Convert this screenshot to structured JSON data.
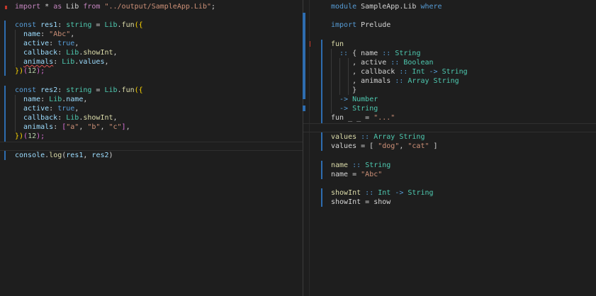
{
  "left": {
    "imp_keyword": "import",
    "imp_star": " * ",
    "imp_as": "as",
    "imp_lib": " Lib ",
    "imp_from": "from",
    "imp_path": "\"../output/SampleApp.Lib\"",
    "imp_semi": ";",
    "res1": {
      "const_kw": "const",
      "name": " res1",
      "colon": ": ",
      "type": "string",
      "eq": " = ",
      "lib": "Lib",
      "dot": ".",
      "fun": "fun",
      "open": "({",
      "name_key": "  name",
      "name_colon": ": ",
      "name_val": "\"Abc\"",
      "name_comma": ",",
      "active_key": "  active",
      "active_colon": ": ",
      "active_val": "true",
      "active_comma": ",",
      "callback_key": "  callback",
      "callback_colon": ": ",
      "callback_lib": "Lib",
      "callback_dot": ".",
      "callback_fn": "showInt",
      "callback_comma": ",",
      "animals_key": "animals",
      "animals_colon": ": ",
      "animals_lib": "Lib",
      "animals_dot": ".",
      "animals_val": "values",
      "animals_comma": ",",
      "close": "})",
      "arg_open": "(",
      "arg": "12",
      "arg_close": ");"
    },
    "res2": {
      "const_kw": "const",
      "name": " res2",
      "colon": ": ",
      "type": "string",
      "eq": " = ",
      "lib": "Lib",
      "dot": ".",
      "fun": "fun",
      "open": "({",
      "name_key": "  name",
      "name_colon": ": ",
      "name_lib": "Lib",
      "name_dot": ".",
      "name_val": "name",
      "name_comma": ",",
      "active_key": "  active",
      "active_colon": ": ",
      "active_val": "true",
      "active_comma": ",",
      "callback_key": "  callback",
      "callback_colon": ": ",
      "callback_lib": "Lib",
      "callback_dot": ".",
      "callback_fn": "showInt",
      "callback_comma": ",",
      "animals_key": "  animals",
      "animals_colon": ": ",
      "arr_open": "[",
      "a": "\"a\"",
      "sep1": ", ",
      "b": "\"b\"",
      "sep2": ", ",
      "c": "\"c\"",
      "arr_close": "]",
      "animals_comma": ",",
      "close": "})",
      "arg_open": "(",
      "arg": "12",
      "arg_close": ");"
    },
    "console": {
      "obj": "console",
      "dot": ".",
      "fn": "log",
      "open": "(",
      "a1": "res1",
      "sep": ", ",
      "a2": "res2",
      "close": ")"
    }
  },
  "right": {
    "module_kw": "module",
    "module_name": " SampleApp.Lib ",
    "where_kw": "where",
    "import_kw": "import",
    "import_mod": " Prelude",
    "fun_name": "fun",
    "sig_line1_op": "  :: ",
    "sig_line1_brace": "{ ",
    "sig_line1_field": "name",
    "sig_line1_dc": " :: ",
    "sig_line1_type": "String",
    "sig_line2_comma": "     , ",
    "sig_line2_field": "active",
    "sig_line2_dc": " :: ",
    "sig_line2_type": "Boolean",
    "sig_line3_comma": "     , ",
    "sig_line3_field": "callback",
    "sig_line3_dc": " :: ",
    "sig_line3_t1": "Int",
    "sig_line3_arrow": " -> ",
    "sig_line3_t2": "String",
    "sig_line4_comma": "     , ",
    "sig_line4_field": "animals",
    "sig_line4_dc": " :: ",
    "sig_line4_type": "Array String",
    "sig_line5_close": "     }",
    "ret1_arrow": "  -> ",
    "ret1_type": "Number",
    "ret2_arrow": "  -> ",
    "ret2_type": "String",
    "fun_def": "fun _ _ = ",
    "fun_def_str": "\"...\"",
    "values_name": "values",
    "values_dc": " :: ",
    "values_type": "Array String",
    "values_def": "values = [ ",
    "values_dog": "\"dog\"",
    "values_sep": ", ",
    "values_cat": "\"cat\"",
    "values_close": " ]",
    "name_name": "name",
    "name_dc": " :: ",
    "name_type": "String",
    "name_def": "name = ",
    "name_str": "\"Abc\"",
    "showint_name": "showInt",
    "showint_dc": " :: ",
    "showint_t1": "Int",
    "showint_arrow": " -> ",
    "showint_t2": "String",
    "showint_def": "showInt = show"
  }
}
